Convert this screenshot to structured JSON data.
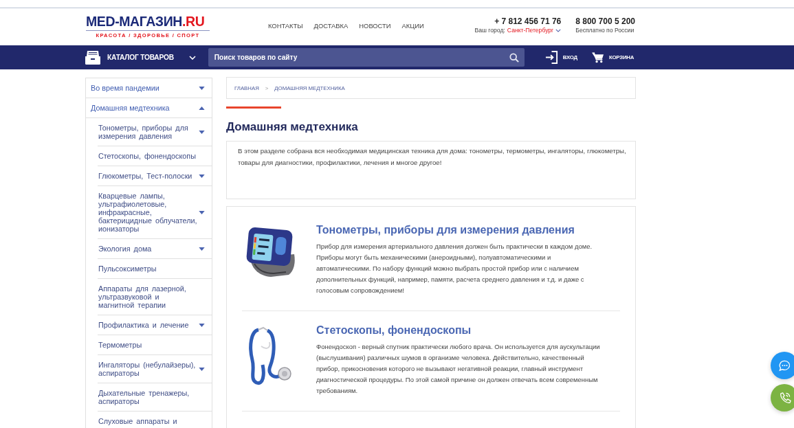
{
  "header": {
    "logo": {
      "name": "MED-МАГАЗИН",
      "domain": ".RU",
      "tagline": "КРАСОТА / ЗДОРОВЬЕ / СПОРТ"
    },
    "nav": [
      {
        "label": "КОНТАКТЫ"
      },
      {
        "label": "ДОСТАВКА"
      },
      {
        "label": "НОВОСТИ"
      },
      {
        "label": "АКЦИИ"
      }
    ],
    "city_phone": {
      "phone": "+ 7 812 456 71 76",
      "city_label": "Ваш город:",
      "city": "Санкт-Петербург"
    },
    "free_phone": {
      "phone": "8 800 700 5 200",
      "note": "Бесплатно по России"
    }
  },
  "navbar": {
    "catalog": "КАТАЛОГ ТОВАРОВ",
    "search": {
      "placeholder": "Поиск товаров по сайту"
    },
    "login": "ВХОД",
    "cart": "КОРЗИНА"
  },
  "sidebar": {
    "items": [
      {
        "kind": "expandable",
        "label": "Во время пандемии",
        "expanded": false
      },
      {
        "kind": "expandable",
        "label": "Домашняя медтехника",
        "expanded": true,
        "children": [
          {
            "kind": "expandable",
            "label": "Тонометры, приборы для измерения давления",
            "expanded": false
          },
          {
            "kind": "link",
            "label": "Стетоскопы, фонендоскопы"
          },
          {
            "kind": "expandable",
            "label": "Глюкометры, Тест-полоски",
            "expanded": false
          },
          {
            "kind": "expandable",
            "label": "Кварцевые лампы, ультрафиолетовые, инфракрасные, бактерицидные облучатели, ионизаторы",
            "expanded": false
          },
          {
            "kind": "expandable",
            "label": "Экология дома",
            "expanded": false
          },
          {
            "kind": "link",
            "label": "Пульсоксиметры"
          },
          {
            "kind": "link",
            "label": "Аппараты для лазерной, ультразвуковой и магнитной терапии"
          },
          {
            "kind": "expandable",
            "label": "Профилактика и лечение",
            "expanded": false
          },
          {
            "kind": "link",
            "label": "Термометры"
          },
          {
            "kind": "expandable",
            "label": "Ингаляторы (небулайзеры), аспираторы",
            "expanded": false
          },
          {
            "kind": "link",
            "label": "Дыхательные тренажеры, аспираторы"
          },
          {
            "kind": "link",
            "label": "Слуховые аппараты и"
          }
        ]
      }
    ]
  },
  "breadcrumbs": {
    "items": [
      {
        "label": "ГЛАВНАЯ"
      },
      {
        "label": "ДОМАШНЯЯ МЕДТЕХНИКА"
      }
    ],
    "separator": ">"
  },
  "page_title": "Домашняя медтехника",
  "intro": "В этом разделе собрана вся необходимая медицинская техника для дома: тонометры, термометры, ингаляторы, глюкометры, товары для диагностики, профилактики, лечения и многое другое!",
  "categories": [
    {
      "kind": "tonometer",
      "title": "Тонометры, приборы для измерения давления",
      "description": "Прибор для измерения артериального давления должен быть практически в каждом доме. Приборы могут быть механическими (анероидными), полуавтоматическими и автоматическими. По набору функций можно выбрать простой прибор или с наличием дополнительных функций, например, памяти, расчета среднего давления и т.д. и даже с голосовым сопровождением!"
    },
    {
      "kind": "stethoscope",
      "title": "Стетоскопы, фонендоскопы",
      "description": "Фонендоскоп - верный спутник практически любого врача. Он используется для аускультации (выслушивания) различных шумов в организме человека. Действительно, качественный прибор, прикосновения которого не вызывают негативной реакции, главный инструмент диагностической процедуры. По этой самой причине он должен отвечать всем современным требованиям."
    }
  ],
  "floating_buttons": [
    {
      "kind": "chat"
    },
    {
      "kind": "call"
    }
  ]
}
